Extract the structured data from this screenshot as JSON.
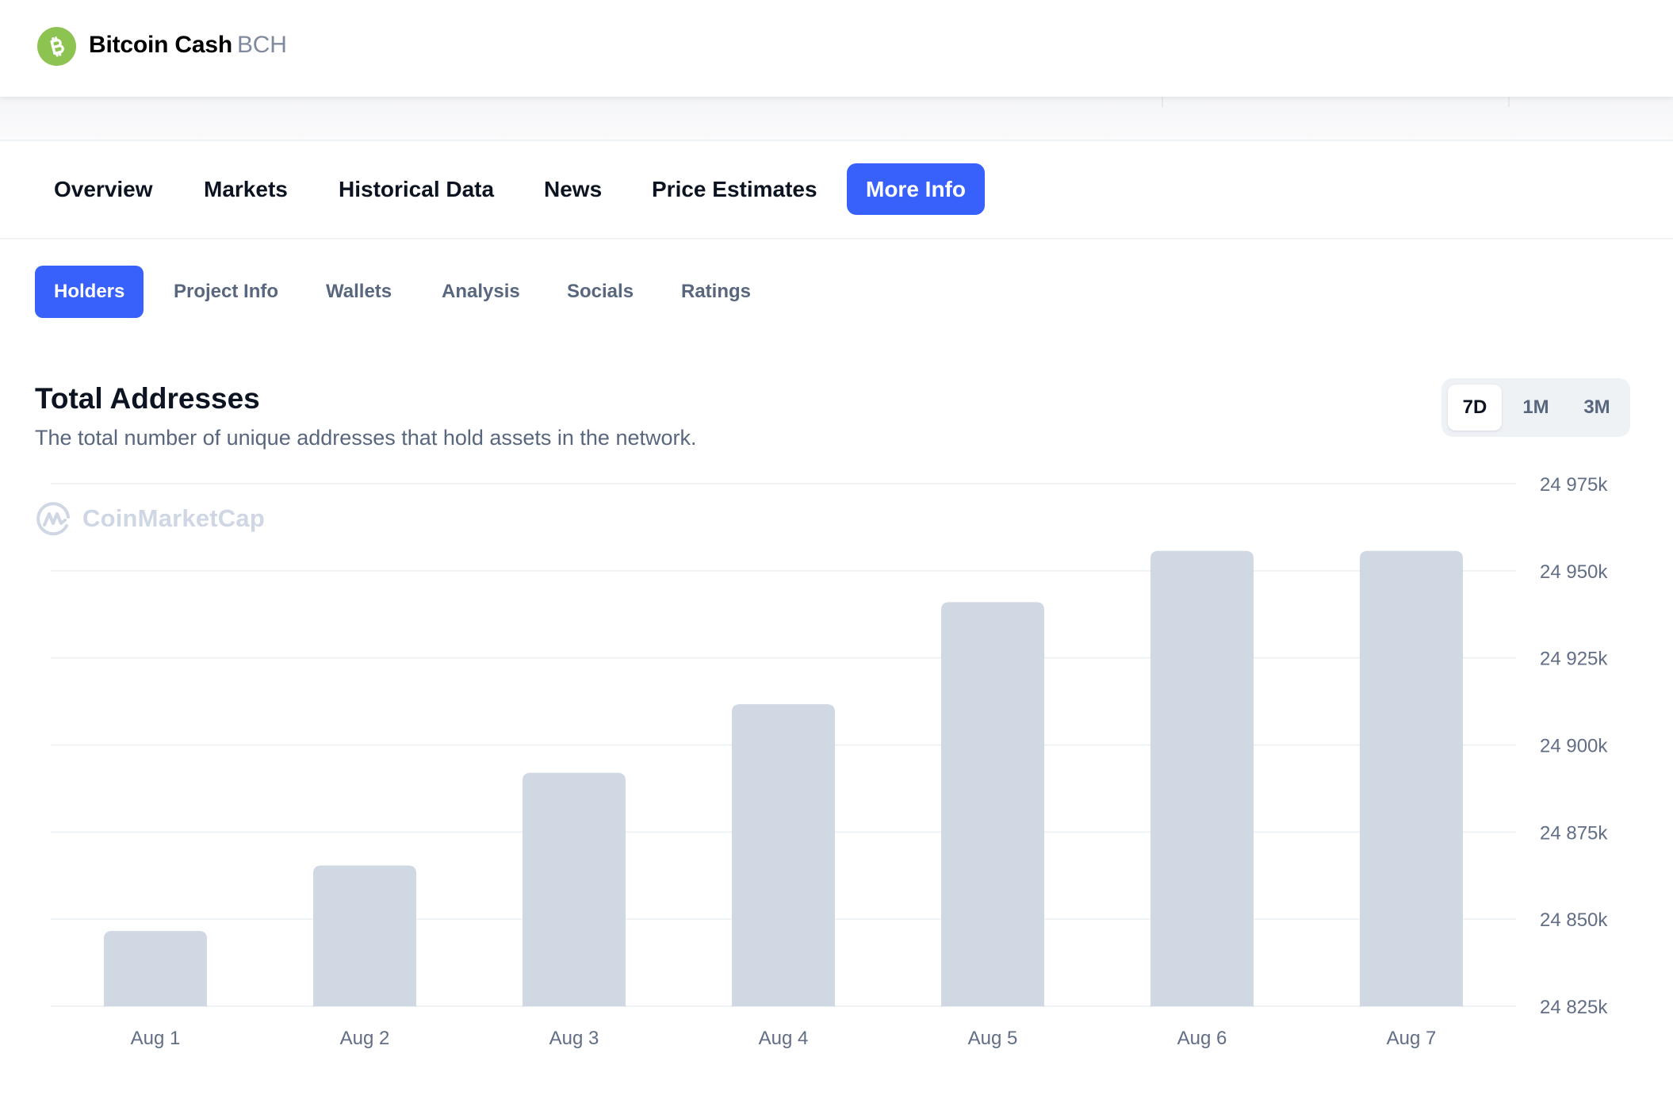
{
  "header": {
    "coin_name": "Bitcoin Cash",
    "coin_symbol": "BCH",
    "logo_icon": "bitcoin-cash-icon",
    "logo_color": "#8dc351"
  },
  "main_tabs": [
    {
      "label": "Overview",
      "active": false
    },
    {
      "label": "Markets",
      "active": false
    },
    {
      "label": "Historical Data",
      "active": false
    },
    {
      "label": "News",
      "active": false
    },
    {
      "label": "Price Estimates",
      "active": false
    },
    {
      "label": "More Info",
      "active": true
    }
  ],
  "sub_tabs": [
    {
      "label": "Holders",
      "active": true
    },
    {
      "label": "Project Info",
      "active": false
    },
    {
      "label": "Wallets",
      "active": false
    },
    {
      "label": "Analysis",
      "active": false
    },
    {
      "label": "Socials",
      "active": false
    },
    {
      "label": "Ratings",
      "active": false
    }
  ],
  "section": {
    "title": "Total Addresses",
    "subtitle": "The total number of unique addresses that hold assets in the network."
  },
  "range_selector": {
    "options": [
      "7D",
      "1M",
      "3M"
    ],
    "selected": "7D"
  },
  "watermark": "CoinMarketCap",
  "colors": {
    "accent": "#3861fb",
    "bar": "#cfd8e3",
    "grid": "#eff2f5",
    "muted_text": "#58667e"
  },
  "chart_data": {
    "type": "bar",
    "title": "Total Addresses",
    "xlabel": "",
    "ylabel": "",
    "categories": [
      "Aug 1",
      "Aug 2",
      "Aug 3",
      "Aug 4",
      "Aug 5",
      "Aug 6",
      "Aug 7"
    ],
    "values": [
      24846600,
      24865400,
      24892000,
      24911700,
      24941000,
      24955700,
      24955700
    ],
    "ylim": [
      24825000,
      24975000
    ],
    "yticks": [
      24825000,
      24850000,
      24875000,
      24900000,
      24925000,
      24950000,
      24975000
    ],
    "ytick_labels": [
      "24 825k",
      "24 850k",
      "24 875k",
      "24 900k",
      "24 925k",
      "24 950k",
      "24 975k"
    ],
    "y_axis_side": "right",
    "grid": true,
    "legend": "none"
  }
}
